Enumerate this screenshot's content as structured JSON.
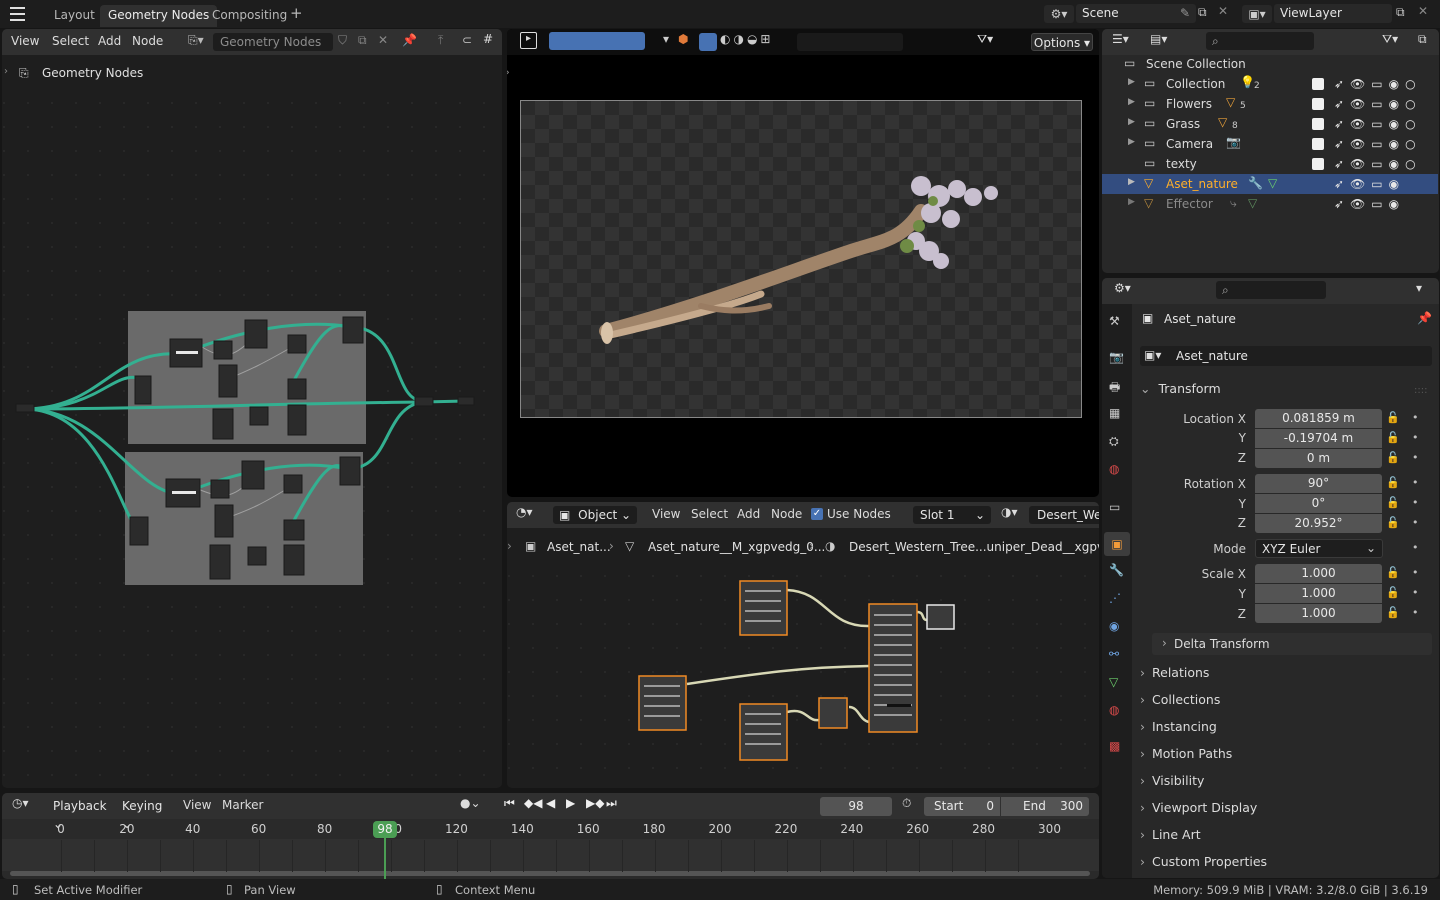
{
  "topbar": {
    "tabs": [
      "Layout",
      "Geometry Nodes",
      "Compositing"
    ],
    "add_tab": "+",
    "scene": "Scene",
    "view_layer": "ViewLayer"
  },
  "geo_editor": {
    "menus": [
      "View",
      "Select",
      "Add",
      "Node"
    ],
    "tree_name": "Geometry Nodes",
    "breadcrumb": "Geometry Nodes"
  },
  "viewport": {
    "options": "Options"
  },
  "shader_editor": {
    "mode": "Object",
    "menus": [
      "View",
      "Select",
      "Add",
      "Node"
    ],
    "use_nodes": "Use Nodes",
    "slot": "Slot 1",
    "material": "Desert_West",
    "breadcrumb": [
      "Aset_nat...",
      "Aset_nature__M_xgpvedg_0...",
      "Desert_Western_Tree...uniper_Dead__xgpvedg"
    ]
  },
  "outliner": {
    "root": "Scene Collection",
    "items": [
      {
        "name": "Collection",
        "badge": "2"
      },
      {
        "name": "Flowers",
        "badge": "5"
      },
      {
        "name": "Grass",
        "badge": "8"
      },
      {
        "name": "Camera",
        "badge": ""
      },
      {
        "name": "texty",
        "badge": ""
      },
      {
        "name": "Aset_nature",
        "badge": ""
      },
      {
        "name": "Effector",
        "badge": ""
      }
    ]
  },
  "properties": {
    "object_name": "Aset_nature",
    "data_name": "Aset_nature",
    "transform_label": "Transform",
    "location_label": "Location X",
    "location": [
      "0.081859 m",
      "-0.19704 m",
      "0 m"
    ],
    "rotation_label": "Rotation X",
    "rotation": [
      "90°",
      "0°",
      "20.952°"
    ],
    "mode_label": "Mode",
    "mode": "XYZ Euler",
    "scale_label": "Scale X",
    "scale": [
      "1.000",
      "1.000",
      "1.000"
    ],
    "axis_y": "Y",
    "axis_z": "Z",
    "delta": "Delta Transform",
    "sections": [
      "Relations",
      "Collections",
      "Instancing",
      "Motion Paths",
      "Visibility",
      "Viewport Display",
      "Line Art",
      "Custom Properties"
    ]
  },
  "timeline": {
    "menus": [
      "Playback",
      "Keying",
      "View",
      "Marker"
    ],
    "current_frame": "98",
    "start_label": "Start",
    "start": "0",
    "end_label": "End",
    "end": "300",
    "ticks": [
      "0",
      "20",
      "40",
      "60",
      "80",
      "100",
      "120",
      "140",
      "160",
      "180",
      "200",
      "220",
      "240",
      "260",
      "280",
      "300"
    ],
    "playhead": "98"
  },
  "statusbar": {
    "left": "Set Active Modifier",
    "middle": "Pan View",
    "right": "Context Menu",
    "memory": "Memory: 509.9 MiB | VRAM: 3.2/8.0 GiB | 3.6.19"
  },
  "colors": {
    "accent": "#4772b3",
    "selected_row": "#334d80",
    "active_text": "#ffaf29",
    "node_link": "#33b091",
    "playhead": "#4b9e54"
  }
}
